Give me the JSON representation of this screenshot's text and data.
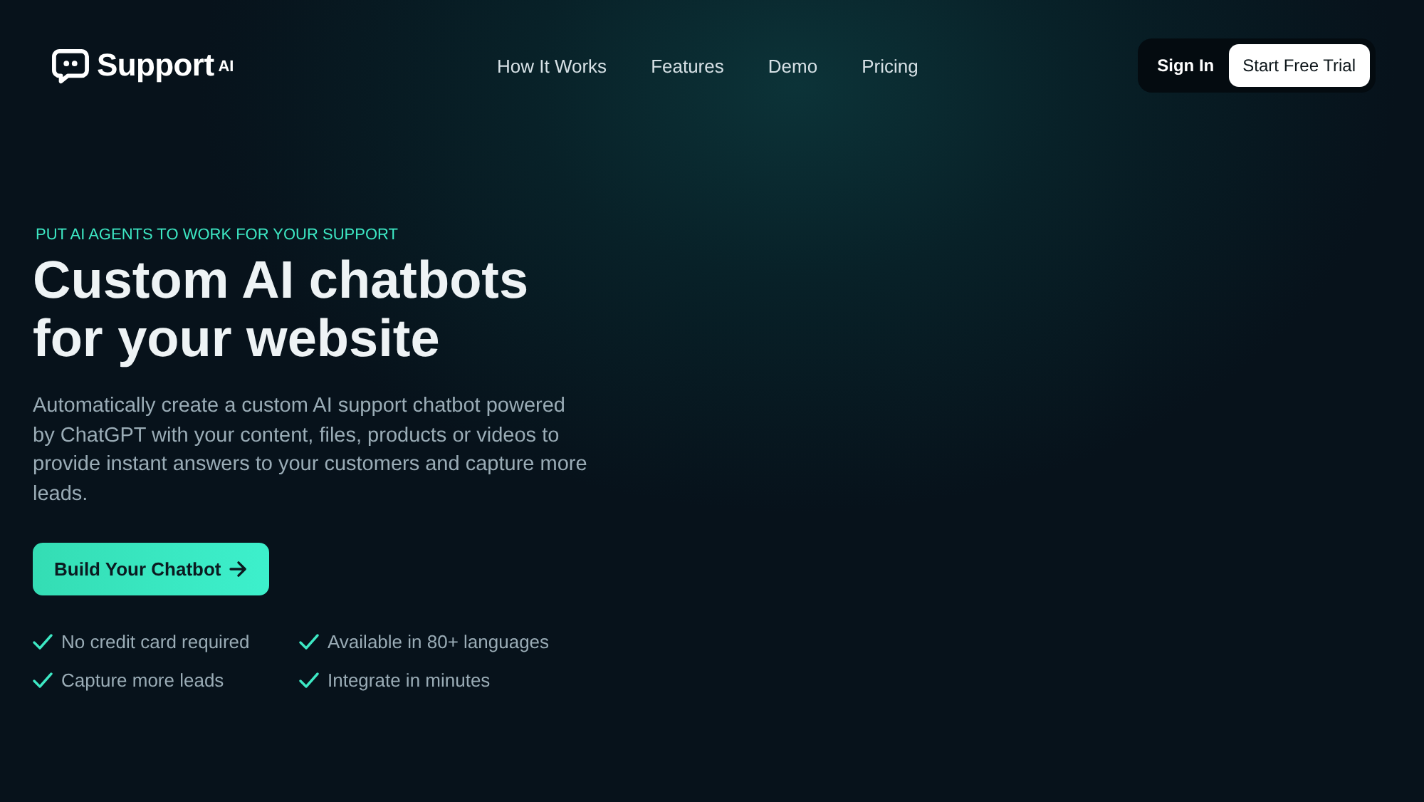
{
  "header": {
    "logo": {
      "name": "Support",
      "badge": "AI"
    },
    "nav": [
      "How It Works",
      "Features",
      "Demo",
      "Pricing"
    ],
    "sign_in": "Sign In",
    "cta": "Start Free Trial"
  },
  "hero": {
    "eyebrow": "PUT AI AGENTS TO WORK FOR YOUR SUPPORT",
    "title_lines": [
      "Custom AI chatbots",
      "for your website"
    ],
    "description": "Automatically create a custom AI support chatbot powered by ChatGPT with your content, files, products or videos to provide instant answers to your customers and capture more leads.",
    "button": "Build Your Chatbot",
    "features": [
      "No credit card required",
      "Available in 80+ languages",
      "Capture more leads",
      "Integrate in minutes"
    ]
  }
}
